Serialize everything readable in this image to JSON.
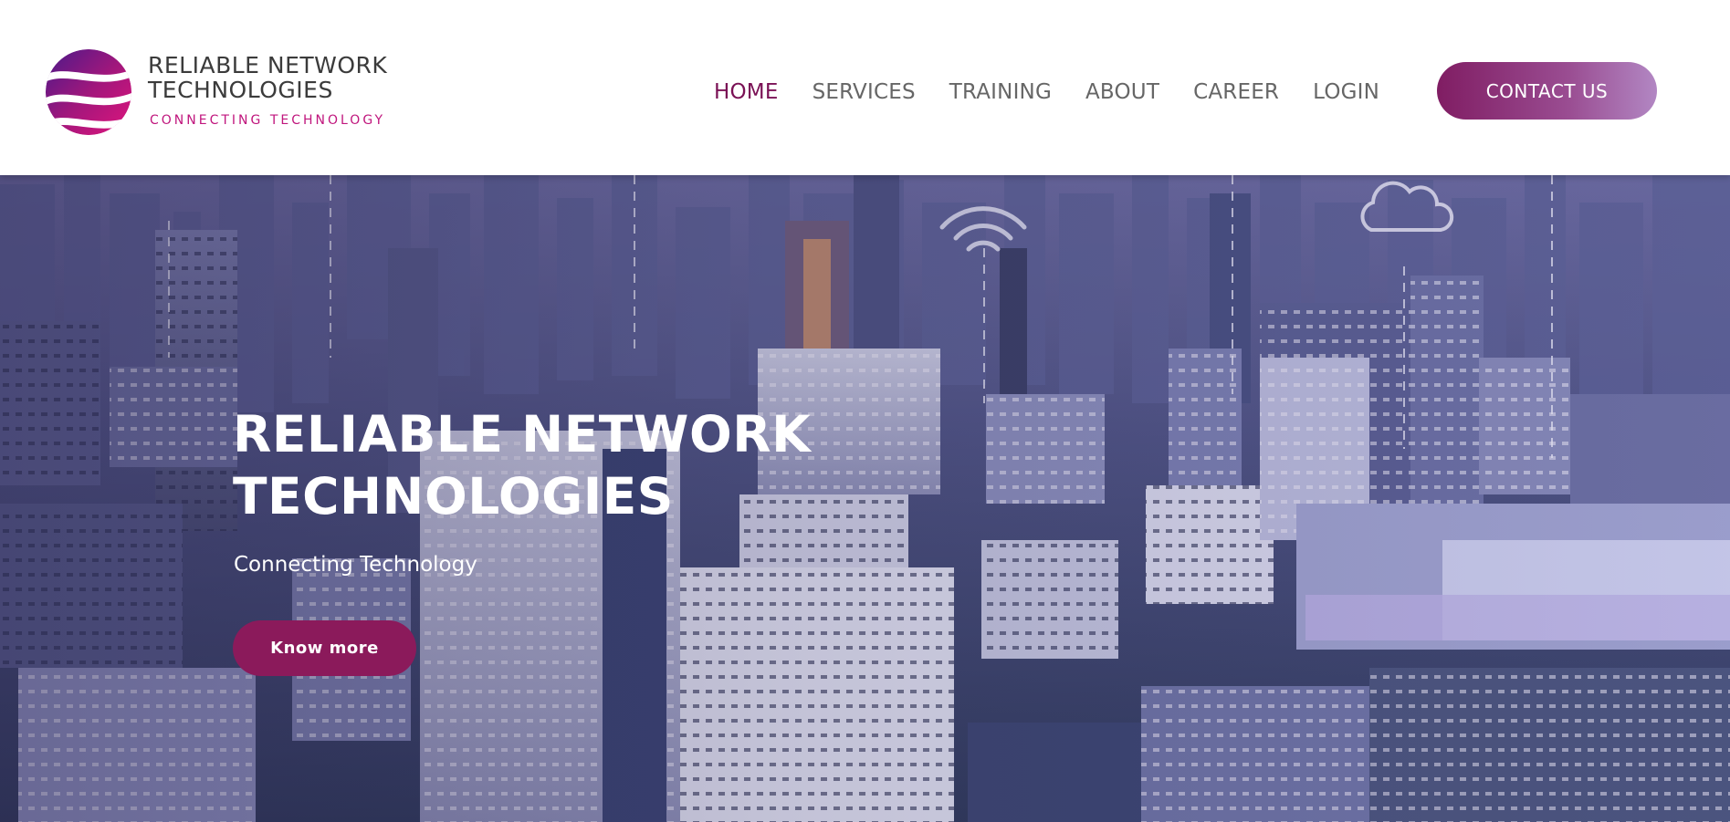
{
  "brand": {
    "name": "RELIABLE NETWORK TECHNOLOGIES",
    "name_line1": "RELIABLE NETWORK",
    "name_line2": "TECHNOLOGIES",
    "tagline": "CONNECTING TECHNOLOGY",
    "logo_icon": "striped-globe-icon",
    "colors": {
      "primary": "#7a1155",
      "accent": "#c0167d",
      "text": "#3b3b3b"
    }
  },
  "nav": {
    "items": [
      {
        "label": "HOME",
        "active": true
      },
      {
        "label": "SERVICES",
        "active": false
      },
      {
        "label": "TRAINING",
        "active": false
      },
      {
        "label": "ABOUT",
        "active": false
      },
      {
        "label": "CAREER",
        "active": false
      },
      {
        "label": "LOGIN",
        "active": false
      }
    ],
    "contact_label": "CONTACT US"
  },
  "hero": {
    "title_line1": "RELIABLE NETWORK",
    "title_line2": "TECHNOLOGIES",
    "subtitle": "Connecting Technology",
    "button_label": "Know more",
    "icons": [
      "wifi-icon",
      "cloud-icon"
    ],
    "button_color": "#8b1a5b"
  }
}
